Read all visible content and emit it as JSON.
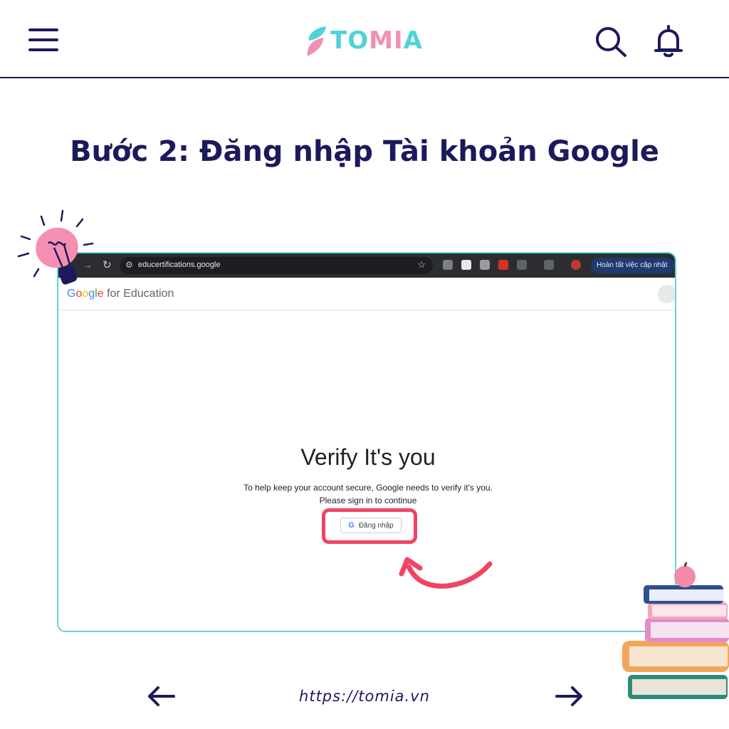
{
  "header": {
    "logo_text_start": "TO",
    "logo_text_mid": "MI",
    "logo_text_end": "A"
  },
  "page_title": "Bước 2: Đăng nhập Tài khoản Google",
  "browser": {
    "url": "educertifications.google",
    "update_button": "Hoàn tất việc cập nhật"
  },
  "google_page": {
    "logo_google": "Google",
    "logo_suffix": "for Education",
    "verify_title": "Verify It's you",
    "desc_line1": "To help keep your account secure, Google needs to verify it's you.",
    "desc_line2": "Please sign in to continue",
    "signin_label": "Đăng nhập"
  },
  "footer": {
    "url": "https://tomia.vn"
  },
  "colors": {
    "navy": "#1c1a5c",
    "teal": "#4fd3d6",
    "pink": "#f48fb1",
    "highlight_red": "#ef4464"
  }
}
